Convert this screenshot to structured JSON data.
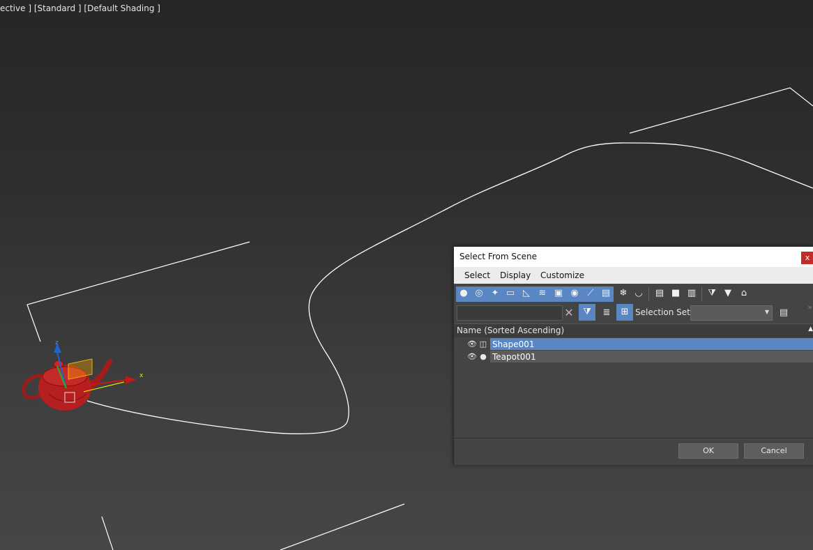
{
  "viewport": {
    "label": "ective ] [Standard ] [Default Shading ]",
    "gizmo": {
      "x_axis": "x",
      "z_axis": "z"
    }
  },
  "dialog": {
    "title": "Select From Scene",
    "close_label": "x",
    "menu": [
      "Select",
      "Display",
      "Customize"
    ],
    "toolbar_icons": [
      "geometry-icon",
      "shapes-icon",
      "lights-icon",
      "cameras-icon",
      "helpers-icon",
      "space-warps-icon",
      "groups-icon",
      "xrefs-icon",
      "bones-icon",
      "containers-icon",
      "frozen-icon",
      "hidden-icon",
      "list-all-icon",
      "list-none-icon",
      "list-invert-icon",
      "filter-config-icon",
      "filter-icon",
      "sync-icon"
    ],
    "search": {
      "value": "",
      "placeholder": ""
    },
    "selection_set_label": "Selection Set:",
    "selection_set_value": "",
    "list_header": "Name (Sorted Ascending)",
    "rows": [
      {
        "name": "Shape001",
        "type_icon": "shape-icon",
        "selected": true
      },
      {
        "name": "Teapot001",
        "type_icon": "geometry-icon",
        "selected": false
      }
    ],
    "ok_label": "OK",
    "cancel_label": "Cancel"
  },
  "colors": {
    "accent": "#5a87c4",
    "selected_row": "#5a87c4",
    "annotation_arrow": "#ff1a1a",
    "teapot": "#b51f1f"
  }
}
